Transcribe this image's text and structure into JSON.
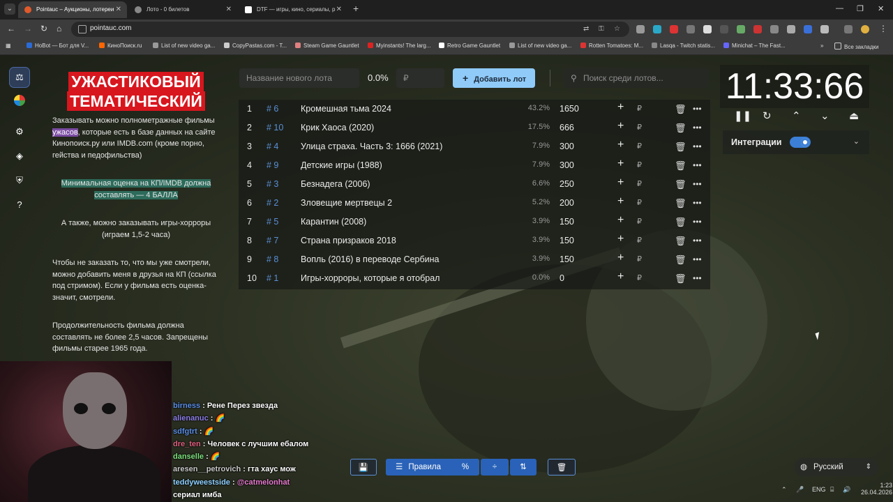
{
  "browser": {
    "tabs": [
      {
        "title": "Pointauc – Аукционы, лотереи",
        "active": true,
        "color": "#e05a2b"
      },
      {
        "title": "Лото - 0 билетов",
        "active": false,
        "color": "#888888"
      },
      {
        "title": "DTF — игры, кино, сериалы, р",
        "active": false,
        "color": "#ffffff"
      }
    ],
    "url": "pointauc.com",
    "bookmarks": [
      {
        "label": "HoBot — Бот для V...",
        "color": "#2a6bd6"
      },
      {
        "label": "КиноПоиск.ru",
        "color": "#f60"
      },
      {
        "label": "List of new video ga...",
        "color": "#999"
      },
      {
        "label": "CopyPastas.com - T...",
        "color": "#ccc"
      },
      {
        "label": "Steam Game Gauntlet",
        "color": "#e08080"
      },
      {
        "label": "Myinstants! The larg...",
        "color": "#d22"
      },
      {
        "label": "Retro Game Gauntlet",
        "color": "#fff"
      },
      {
        "label": "List of new video ga...",
        "color": "#999"
      },
      {
        "label": "Rotten Tomatoes: M...",
        "color": "#d33"
      },
      {
        "label": "Lasqa - Twitch statis...",
        "color": "#888"
      },
      {
        "label": "Minichat – The Fast...",
        "color": "#66f"
      }
    ],
    "all_bookmarks": "Все закладки"
  },
  "rules": {
    "title_line1": "УЖАСТИКОВЫЙ",
    "title_line2": "ТЕМАТИЧЕСКИЙ",
    "p1_a": "Заказывать можно полнометражные фильмы ",
    "p1_hl": "ужасов",
    "p1_b": ", которые есть в базе данных на сайте Кинопоиск.ру или IMDB.com (кроме порно, гейства и педофильства)",
    "p2": "Минимальная оценка на КП/IMDB должна составлять — 4 БАЛЛА",
    "p3": "А также, можно заказывать игры-хорроры (играем 1,5-2 часа)",
    "p4": "Чтобы не заказать то, что мы уже смотрели, можно добавить меня в друзья на КП (ссылка под стримом). Если у фильма есть оценка- значит, смотрели.",
    "p5": "Продолжительность фильма должна составлять не более 2,5 часов. Запрещены фильмы старее 1965 года."
  },
  "controls": {
    "new_lot_placeholder": "Название нового лота",
    "percent": "0.0%",
    "amount_placeholder": "₽",
    "add_button": "Добавить лот",
    "search_placeholder": "Поиск среди лотов..."
  },
  "lots": [
    {
      "num": "1",
      "id": "# 6",
      "name": "Кромешная тьма 2024",
      "pct": "43.2%",
      "amount": "1650"
    },
    {
      "num": "2",
      "id": "# 10",
      "name": "Крик Хаоса (2020)",
      "pct": "17.5%",
      "amount": "666"
    },
    {
      "num": "3",
      "id": "# 4",
      "name": "Улица страха. Часть 3: 1666 (2021)",
      "pct": "7.9%",
      "amount": "300"
    },
    {
      "num": "4",
      "id": "# 9",
      "name": "Детские игры (1988)",
      "pct": "7.9%",
      "amount": "300"
    },
    {
      "num": "5",
      "id": "# 3",
      "name": "Безнадега (2006)",
      "pct": "6.6%",
      "amount": "250"
    },
    {
      "num": "6",
      "id": "# 2",
      "name": "Зловещие мертвецы 2",
      "pct": "5.2%",
      "amount": "200"
    },
    {
      "num": "7",
      "id": "# 5",
      "name": "Карантин (2008)",
      "pct": "3.9%",
      "amount": "150"
    },
    {
      "num": "8",
      "id": "# 7",
      "name": "Страна призраков 2018",
      "pct": "3.9%",
      "amount": "150"
    },
    {
      "num": "9",
      "id": "# 8",
      "name": "Вопль (2016) в переводе Сербина",
      "pct": "3.9%",
      "amount": "150"
    },
    {
      "num": "10",
      "id": "# 1",
      "name": "Игры-хорроры, которые я отобрал",
      "pct": "0.0%",
      "amount": "0"
    }
  ],
  "timer": {
    "display": "11:33:66"
  },
  "integrations": {
    "label": "Интеграции",
    "enabled": true
  },
  "bottom": {
    "rules_button": "Правила",
    "percent_symbol": "%"
  },
  "language": {
    "current": "Русский"
  },
  "chat": [
    {
      "user": "birness",
      "color": "#5b8ee6",
      "msg": "Рене Перез звезда"
    },
    {
      "user": "alienanuc",
      "color": "#8c7ee8",
      "msg": ""
    },
    {
      "user": "sdfgtrt",
      "color": "#5b8ee6",
      "msg": ""
    },
    {
      "user": "dre_ten",
      "color": "#e06080",
      "msg": "Человек с лучшим ебалом"
    },
    {
      "user": "danselle",
      "color": "#7ee07e",
      "msg": ""
    },
    {
      "user": "aresen__petrovich",
      "color": "#c9c9c9",
      "msg": "гта хаус мож"
    },
    {
      "user": "teddyweestside",
      "color": "#8fd0ff",
      "msg": "@catmelonhat"
    },
    {
      "user": "",
      "color": "#ffffff",
      "msg": "сериал имба"
    }
  ],
  "taskbar": {
    "lang": "ENG",
    "time": "1:23",
    "date": "26.04.2026"
  }
}
